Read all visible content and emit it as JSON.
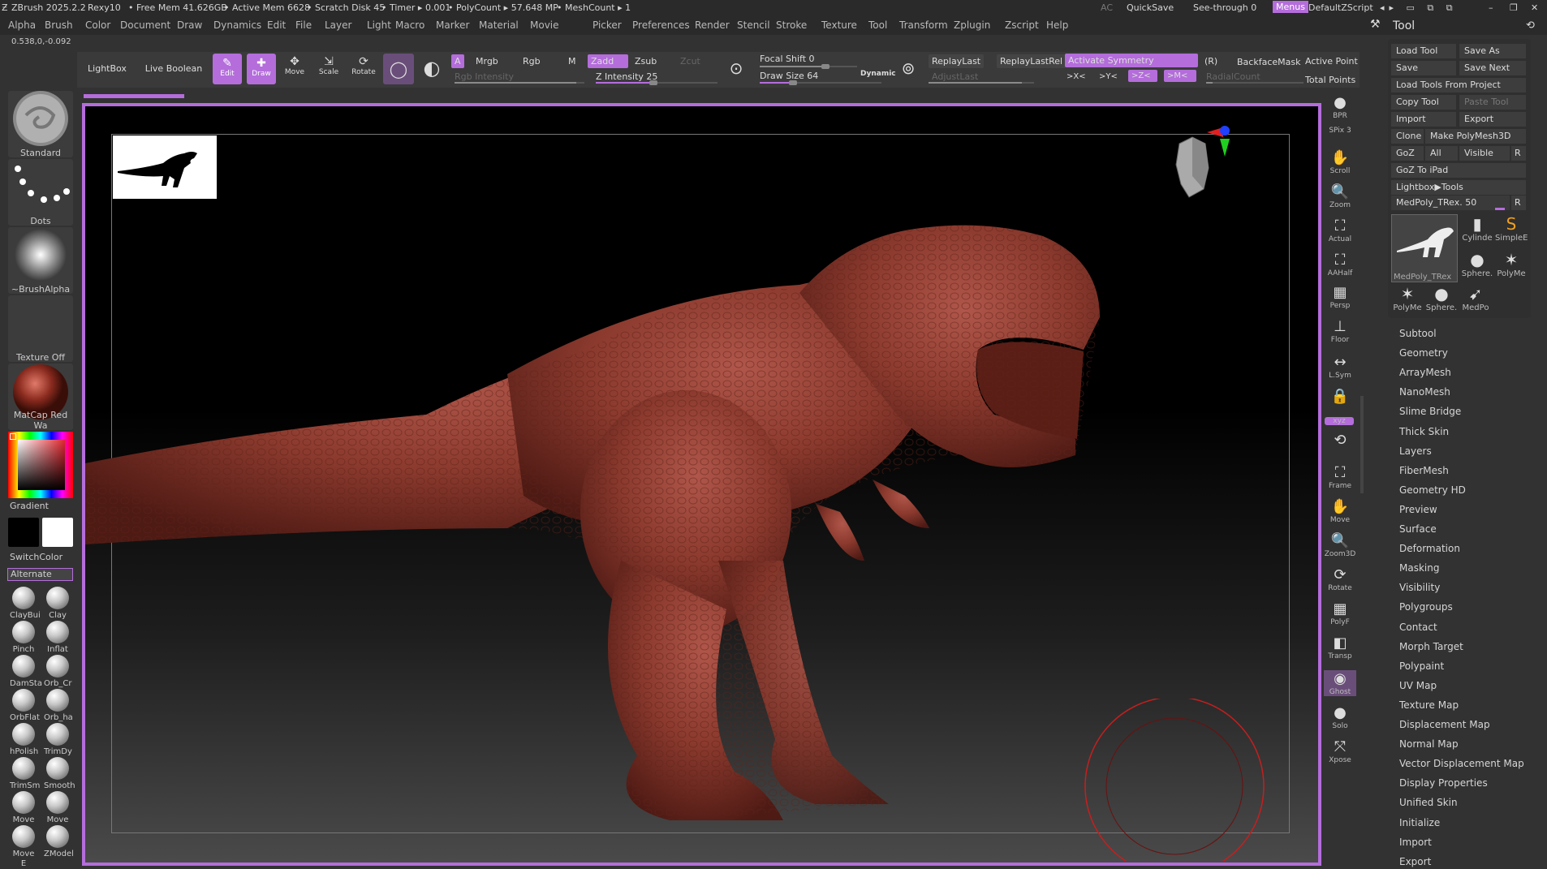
{
  "titlebar": {
    "app_name": "ZBrush 2025.2.2",
    "project": "Rexy10",
    "free_mem": "• Free Mem 41.626GB",
    "active_mem": "• Active Mem 6628",
    "scratch": "• Scratch Disk 45",
    "timer": "• Timer ▸ 0.001",
    "polycount": "• PolyCount ▸ 57.648 MP",
    "meshcount": "• MeshCount ▸ 1",
    "ac": "AC",
    "quicksave": "QuickSave",
    "see_through": "See-through",
    "see_through_value": "0",
    "menus": "Menus",
    "default_zscript": "DefaultZScript"
  },
  "menu": [
    "Alpha",
    "Brush",
    "Color",
    "Document",
    "Draw",
    "Dynamics",
    "Edit",
    "File",
    "Layer",
    "Light",
    "Macro",
    "Marker",
    "Material",
    "Movie",
    "Picker",
    "Preferences",
    "Render",
    "Stencil",
    "Stroke",
    "Texture",
    "Tool",
    "Transform",
    "Zplugin",
    "Zscript",
    "Help"
  ],
  "coords": "0.538,0,-0.092",
  "shelf": {
    "lightbox": "LightBox",
    "live_boolean": "Live Boolean",
    "edit": "Edit",
    "draw": "Draw",
    "move": "Move",
    "scale": "Scale",
    "rotate": "Rotate",
    "a": "A",
    "mrgb": "Mrgb",
    "rgb": "Rgb",
    "m": "M",
    "zadd": "Zadd",
    "zsub": "Zsub",
    "zcut": "Zcut",
    "rgb_intensity": "Rgb Intensity",
    "z_intensity": "Z Intensity 25",
    "focal_shift": "Focal Shift 0",
    "draw_size": "Draw Size 64",
    "dynamic": "Dynamic",
    "replay_last": "ReplayLast",
    "replay_last_rel": "ReplayLastRel",
    "activate_symmetry": "Activate Symmetry",
    "sym_r": "(R)",
    "adjust_last": "AdjustLast",
    "sym_x": ">X<",
    "sym_y": ">Y<",
    "sym_z": ">Z<",
    "sym_m": ">M<",
    "radial_count": "RadialCount",
    "backface_mask": "BackfaceMask",
    "active_point": "Active Point",
    "total_points": "Total Points"
  },
  "left": {
    "brush_name": "Standard",
    "stroke_name": "Dots",
    "alpha_name": "~BrushAlpha",
    "texture_name": "Texture Off",
    "material_name": "MatCap Red Wa",
    "gradient": "Gradient",
    "switch_color": "SwitchColor",
    "alternate": "Alternate",
    "brushes": [
      "ClayBui",
      "Clay",
      "Pinch",
      "Inflat",
      "DamSta",
      "Orb_Cr",
      "OrbFlat",
      "Orb_ha",
      "hPolish",
      "TrimDy",
      "TrimSm",
      "Smooth",
      "Move E",
      "Move T",
      "Move E",
      "ZModel"
    ]
  },
  "right_shelf": [
    {
      "glyph": "●",
      "label": "BPR"
    },
    {
      "glyph": "",
      "label": "SPix 3"
    },
    {
      "glyph": "✋",
      "label": "Scroll"
    },
    {
      "glyph": "🔍",
      "label": "Zoom"
    },
    {
      "glyph": "⛶",
      "label": "Actual"
    },
    {
      "glyph": "⛶",
      "label": "AAHalf"
    },
    {
      "glyph": "▦",
      "label": "Persp"
    },
    {
      "glyph": "⊥",
      "label": "Floor"
    },
    {
      "glyph": "↔",
      "label": "L.Sym"
    },
    {
      "glyph": "🔒",
      "label": ""
    },
    {
      "glyph": "",
      "label": "xyz"
    },
    {
      "glyph": "⟲",
      "label": ""
    },
    {
      "glyph": "⛶",
      "label": "Frame"
    },
    {
      "glyph": "✋",
      "label": "Move"
    },
    {
      "glyph": "🔍",
      "label": "Zoom3D"
    },
    {
      "glyph": "⟳",
      "label": "Rotate"
    },
    {
      "glyph": "▦",
      "label": "PolyF"
    },
    {
      "glyph": "◧",
      "label": "Transp"
    },
    {
      "glyph": "◉",
      "label": "Ghost"
    },
    {
      "glyph": "●",
      "label": "Solo"
    },
    {
      "glyph": "⤧",
      "label": "Xpose"
    }
  ],
  "tool_panel": {
    "title": "Tool",
    "load_tool": "Load Tool",
    "save_as": "Save As",
    "save": "Save",
    "save_next": "Save Next",
    "load_tools_from_project": "Load Tools From Project",
    "copy_tool": "Copy Tool",
    "paste_tool": "Paste Tool",
    "import": "Import",
    "export": "Export",
    "clone": "Clone",
    "make_polymesh": "Make PolyMesh3D",
    "goz": "GoZ",
    "all": "All",
    "visible": "Visible",
    "r": "R",
    "goz_ipad": "GoZ To iPad",
    "lightbox_tools": "Lightbox▶Tools",
    "current_tool": "MedPoly_TRex. 50",
    "thumbs": [
      "MedPoly_TRex",
      "Cylinde",
      "SimpleE",
      "Sphere.",
      "PolyMe",
      "PolyMe",
      "Sphere.",
      "MedPo"
    ]
  },
  "subpalettes": [
    "Subtool",
    "Geometry",
    "ArrayMesh",
    "NanoMesh",
    "Slime Bridge",
    "Thick Skin",
    "Layers",
    "FiberMesh",
    "Geometry HD",
    "Preview",
    "Surface",
    "Deformation",
    "Masking",
    "Visibility",
    "Polygroups",
    "Contact",
    "Morph Target",
    "Polypaint",
    "UV Map",
    "Texture Map",
    "Displacement Map",
    "Normal Map",
    "Vector Displacement Map",
    "Display Properties",
    "Unified Skin",
    "Initialize",
    "Import",
    "Export"
  ],
  "colors": {
    "accent": "#b46ddb",
    "model": "#8c3a2e",
    "bg": "#323232"
  }
}
